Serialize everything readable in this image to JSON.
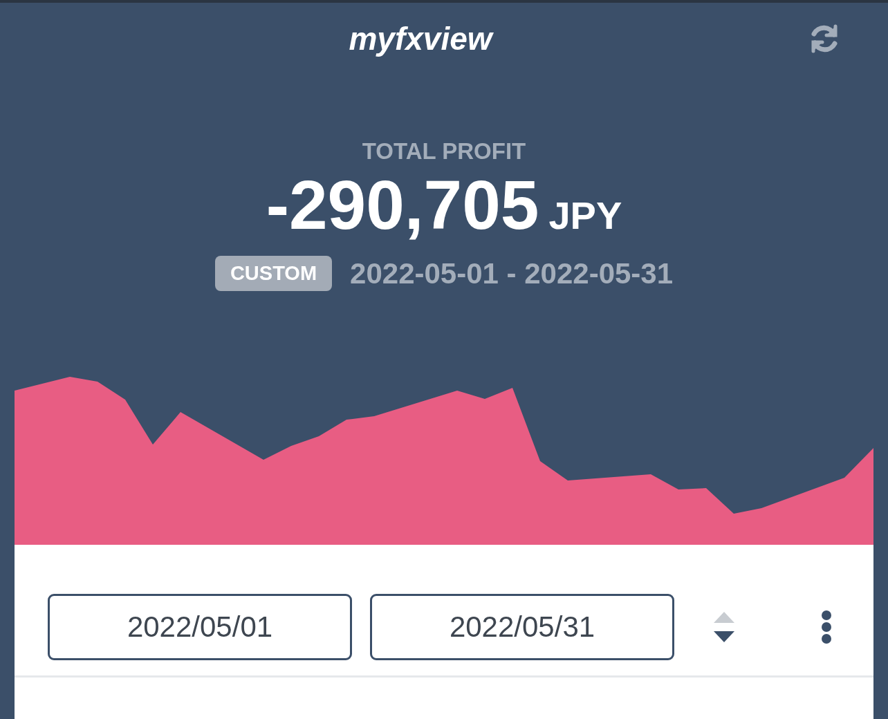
{
  "header": {
    "title": "myfxview"
  },
  "summary": {
    "label": "TOTAL PROFIT",
    "amount": "-290,705",
    "currency": "JPY",
    "period_badge": "CUSTOM",
    "date_range": "2022-05-01 - 2022-05-31"
  },
  "filters": {
    "start_date": "2022/05/01",
    "end_date": "2022/05/31"
  }
}
